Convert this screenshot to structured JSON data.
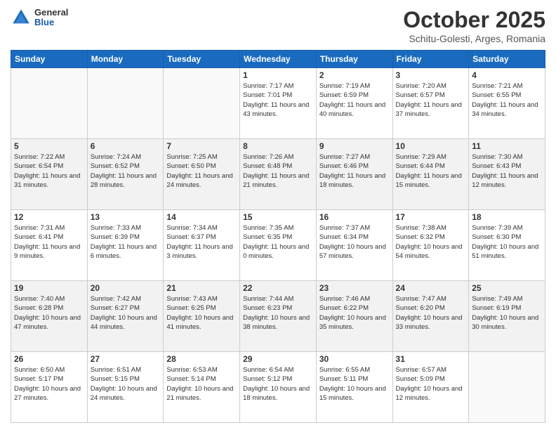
{
  "header": {
    "logo_general": "General",
    "logo_blue": "Blue",
    "title": "October 2025",
    "subtitle": "Schitu-Golesti, Arges, Romania"
  },
  "weekdays": [
    "Sunday",
    "Monday",
    "Tuesday",
    "Wednesday",
    "Thursday",
    "Friday",
    "Saturday"
  ],
  "weeks": [
    [
      {
        "day": "",
        "info": ""
      },
      {
        "day": "",
        "info": ""
      },
      {
        "day": "",
        "info": ""
      },
      {
        "day": "1",
        "info": "Sunrise: 7:17 AM\nSunset: 7:01 PM\nDaylight: 11 hours and 43 minutes."
      },
      {
        "day": "2",
        "info": "Sunrise: 7:19 AM\nSunset: 6:59 PM\nDaylight: 11 hours and 40 minutes."
      },
      {
        "day": "3",
        "info": "Sunrise: 7:20 AM\nSunset: 6:57 PM\nDaylight: 11 hours and 37 minutes."
      },
      {
        "day": "4",
        "info": "Sunrise: 7:21 AM\nSunset: 6:55 PM\nDaylight: 11 hours and 34 minutes."
      }
    ],
    [
      {
        "day": "5",
        "info": "Sunrise: 7:22 AM\nSunset: 6:54 PM\nDaylight: 11 hours and 31 minutes."
      },
      {
        "day": "6",
        "info": "Sunrise: 7:24 AM\nSunset: 6:52 PM\nDaylight: 11 hours and 28 minutes."
      },
      {
        "day": "7",
        "info": "Sunrise: 7:25 AM\nSunset: 6:50 PM\nDaylight: 11 hours and 24 minutes."
      },
      {
        "day": "8",
        "info": "Sunrise: 7:26 AM\nSunset: 6:48 PM\nDaylight: 11 hours and 21 minutes."
      },
      {
        "day": "9",
        "info": "Sunrise: 7:27 AM\nSunset: 6:46 PM\nDaylight: 11 hours and 18 minutes."
      },
      {
        "day": "10",
        "info": "Sunrise: 7:29 AM\nSunset: 6:44 PM\nDaylight: 11 hours and 15 minutes."
      },
      {
        "day": "11",
        "info": "Sunrise: 7:30 AM\nSunset: 6:43 PM\nDaylight: 11 hours and 12 minutes."
      }
    ],
    [
      {
        "day": "12",
        "info": "Sunrise: 7:31 AM\nSunset: 6:41 PM\nDaylight: 11 hours and 9 minutes."
      },
      {
        "day": "13",
        "info": "Sunrise: 7:33 AM\nSunset: 6:39 PM\nDaylight: 11 hours and 6 minutes."
      },
      {
        "day": "14",
        "info": "Sunrise: 7:34 AM\nSunset: 6:37 PM\nDaylight: 11 hours and 3 minutes."
      },
      {
        "day": "15",
        "info": "Sunrise: 7:35 AM\nSunset: 6:35 PM\nDaylight: 11 hours and 0 minutes."
      },
      {
        "day": "16",
        "info": "Sunrise: 7:37 AM\nSunset: 6:34 PM\nDaylight: 10 hours and 57 minutes."
      },
      {
        "day": "17",
        "info": "Sunrise: 7:38 AM\nSunset: 6:32 PM\nDaylight: 10 hours and 54 minutes."
      },
      {
        "day": "18",
        "info": "Sunrise: 7:39 AM\nSunset: 6:30 PM\nDaylight: 10 hours and 51 minutes."
      }
    ],
    [
      {
        "day": "19",
        "info": "Sunrise: 7:40 AM\nSunset: 6:28 PM\nDaylight: 10 hours and 47 minutes."
      },
      {
        "day": "20",
        "info": "Sunrise: 7:42 AM\nSunset: 6:27 PM\nDaylight: 10 hours and 44 minutes."
      },
      {
        "day": "21",
        "info": "Sunrise: 7:43 AM\nSunset: 6:25 PM\nDaylight: 10 hours and 41 minutes."
      },
      {
        "day": "22",
        "info": "Sunrise: 7:44 AM\nSunset: 6:23 PM\nDaylight: 10 hours and 38 minutes."
      },
      {
        "day": "23",
        "info": "Sunrise: 7:46 AM\nSunset: 6:22 PM\nDaylight: 10 hours and 35 minutes."
      },
      {
        "day": "24",
        "info": "Sunrise: 7:47 AM\nSunset: 6:20 PM\nDaylight: 10 hours and 33 minutes."
      },
      {
        "day": "25",
        "info": "Sunrise: 7:49 AM\nSunset: 6:19 PM\nDaylight: 10 hours and 30 minutes."
      }
    ],
    [
      {
        "day": "26",
        "info": "Sunrise: 6:50 AM\nSunset: 5:17 PM\nDaylight: 10 hours and 27 minutes."
      },
      {
        "day": "27",
        "info": "Sunrise: 6:51 AM\nSunset: 5:15 PM\nDaylight: 10 hours and 24 minutes."
      },
      {
        "day": "28",
        "info": "Sunrise: 6:53 AM\nSunset: 5:14 PM\nDaylight: 10 hours and 21 minutes."
      },
      {
        "day": "29",
        "info": "Sunrise: 6:54 AM\nSunset: 5:12 PM\nDaylight: 10 hours and 18 minutes."
      },
      {
        "day": "30",
        "info": "Sunrise: 6:55 AM\nSunset: 5:11 PM\nDaylight: 10 hours and 15 minutes."
      },
      {
        "day": "31",
        "info": "Sunrise: 6:57 AM\nSunset: 5:09 PM\nDaylight: 10 hours and 12 minutes."
      },
      {
        "day": "",
        "info": ""
      }
    ]
  ]
}
